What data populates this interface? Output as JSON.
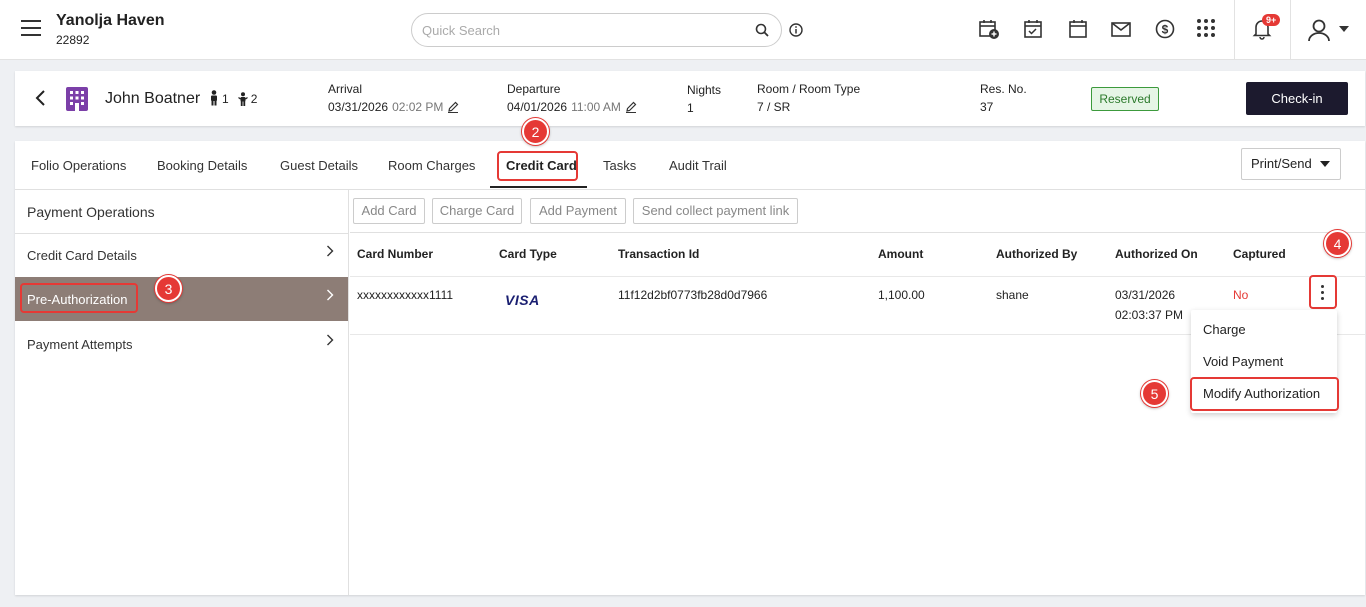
{
  "header": {
    "property_name": "Yanolja Haven",
    "property_code": "22892",
    "search_placeholder": "Quick Search",
    "notification_badge": "9+"
  },
  "reservation": {
    "guest_name": "John Boatner",
    "adults": "1",
    "children": "2",
    "arrival_label": "Arrival",
    "arrival_date": "03/31/2026",
    "arrival_time": "02:02 PM",
    "departure_label": "Departure",
    "departure_date": "04/01/2026",
    "departure_time": "11:00 AM",
    "nights_label": "Nights",
    "nights": "1",
    "room_label": "Room / Room Type",
    "room": "7 / SR",
    "resno_label": "Res. No.",
    "resno": "37",
    "status": "Reserved",
    "checkin_label": "Check-in"
  },
  "tabs": [
    "Folio Operations",
    "Booking Details",
    "Guest Details",
    "Room Charges",
    "Credit Card",
    "Tasks",
    "Audit Trail"
  ],
  "print_label": "Print/Send",
  "left_pane": {
    "title": "Payment Operations",
    "items": [
      "Credit Card Details",
      "Pre-Authorization",
      "Payment Attempts"
    ]
  },
  "actions": [
    "Add Card",
    "Charge Card",
    "Add Payment",
    "Send collect payment link"
  ],
  "table": {
    "columns": [
      "Card Number",
      "Card Type",
      "Transaction Id",
      "Amount",
      "Authorized By",
      "Authorized On",
      "Captured"
    ],
    "rows": [
      {
        "card_number": "xxxxxxxxxxxx1111",
        "card_type": "VISA",
        "transaction_id": "11f12d2bf0773fb28d0d7966",
        "amount": "1,100.00",
        "authorized_by": "shane",
        "authorized_on_date": "03/31/2026",
        "authorized_on_time": "02:03:37 PM",
        "captured": "No"
      }
    ]
  },
  "menu": [
    "Charge",
    "Void Payment",
    "Modify Authorization"
  ],
  "steps": [
    "2",
    "3",
    "4",
    "5"
  ],
  "colors": {
    "accent_red": "#e53935",
    "dark_button": "#1c1a2e",
    "active_item": "#8d7d76",
    "reserved_green": "#3c9a3c"
  }
}
